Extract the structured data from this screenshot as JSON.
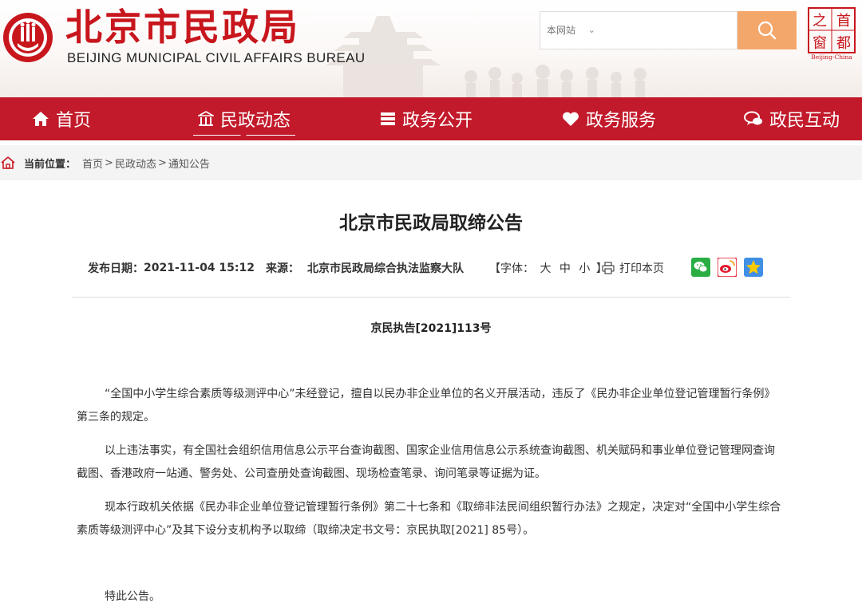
{
  "header": {
    "title": "北京市民政局",
    "subtitle": "BEIJING MUNICIPAL CIVIL AFFAIRS BUREAU",
    "capital_logo_chars": [
      "之",
      "首",
      "窗",
      "都"
    ],
    "capital_logo_caption": "Beijing-China"
  },
  "search": {
    "scope": "本网站",
    "placeholder": "",
    "icon": "search-icon"
  },
  "nav": {
    "items": [
      {
        "label": "首页",
        "icon": "home-icon"
      },
      {
        "label": "民政动态",
        "icon": "building-icon"
      },
      {
        "label": "政务公开",
        "icon": "list-icon"
      },
      {
        "label": "政务服务",
        "icon": "heart-icon"
      },
      {
        "label": "政民互动",
        "icon": "chat-icon"
      }
    ],
    "active": "民政动态"
  },
  "breadcrumb": {
    "label": "当前位置：",
    "items": [
      "首页",
      "民政动态",
      "通知公告"
    ],
    "separator": ">"
  },
  "article": {
    "title": "北京市民政局取缔公告",
    "date_label": "发布日期：",
    "date": "2021-11-04 15:12",
    "source_label": "来源：",
    "source": "北京市民政局综合执法监察大队",
    "font_label_open": "【字体：",
    "font_sizes": [
      "大",
      "中",
      "小"
    ],
    "font_label_close": "】",
    "print_label": "打印本页",
    "share_icons": [
      "wechat-icon",
      "weibo-icon",
      "qzone-icon"
    ],
    "doc_number": "京民执告[2021]113号",
    "paragraphs": [
      "“全国中小学生综合素质等级测评中心”未经登记，擅自以民办非企业单位的名义开展活动，违反了《民办非企业单位登记管理暂行条例》第三条的规定。",
      "以上违法事实，有全国社会组织信用信息公示平台查询截图、国家企业信用信息公示系统查询截图、机关赋码和事业单位登记管理网查询截图、香港政府一站通、警务处、公司查册处查询截图、现场检查笔录、询问笔录等证据为证。",
      "现本行政机关依据《民办非企业单位登记管理暂行条例》第二十七条和《取缔非法民间组织暂行办法》之规定，决定对“全国中小学生综合素质等级测评中心”及其下设分支机构予以取缔（取缔决定书文号：京民执取[2021] 85号）。",
      "特此公告。"
    ]
  },
  "colors": {
    "brand_red": "#c21a2b",
    "title_red": "#c8161d",
    "search_button": "#f4a76a",
    "breadcrumb_bg": "#f4f4f4"
  }
}
